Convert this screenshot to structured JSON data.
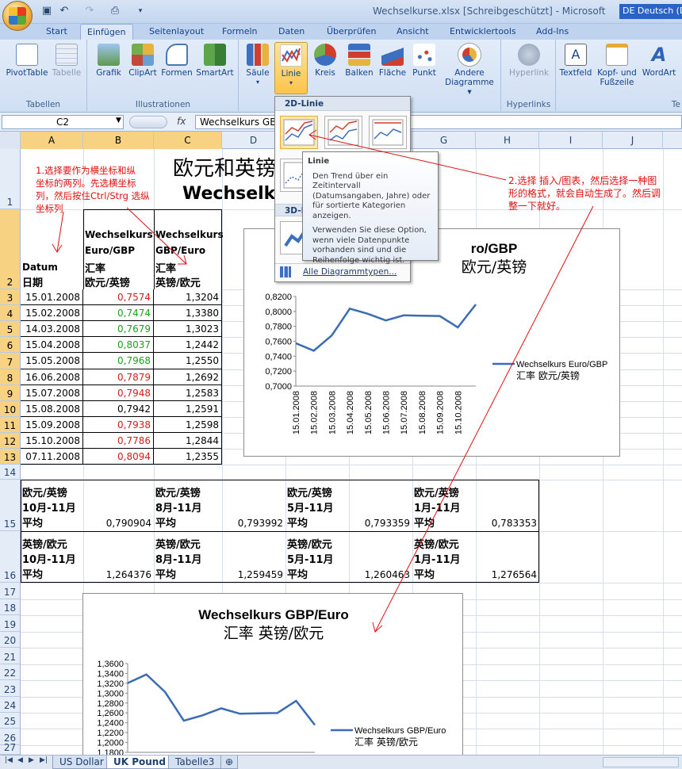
{
  "app": {
    "title": "Wechselkurse.xlsx  [Schreibgeschützt] - Microsoft",
    "lang": "DE Deutsch (D"
  },
  "tabs": [
    "Start",
    "Einfügen",
    "Seitenlayout",
    "Formeln",
    "Daten",
    "Überprüfen",
    "Ansicht",
    "Entwicklertools",
    "Add-Ins"
  ],
  "ribbon": {
    "tabellen": {
      "label": "Tabellen",
      "pivot": "PivotTable",
      "tabelle": "Tabelle"
    },
    "illu": {
      "label": "Illustrationen",
      "grafik": "Grafik",
      "clipart": "ClipArt",
      "formen": "Formen",
      "smartart": "SmartArt"
    },
    "charts": {
      "saule": "Säule",
      "linie": "Linie",
      "kreis": "Kreis",
      "balken": "Balken",
      "flache": "Fläche",
      "punkt": "Punkt",
      "andere1": "Andere",
      "andere2": "Diagramme ▾"
    },
    "hyper": {
      "label": "Hyperlinks",
      "hyperlink": "Hyperlink"
    },
    "text": {
      "textfeld": "Textfeld",
      "kopf1": "Kopf- und",
      "kopf2": "Fußzeile",
      "wordart": "WordArt",
      "label": "Te"
    }
  },
  "formula": {
    "namebox": "C2",
    "fx": "fx",
    "value": "Wechselkurs GB"
  },
  "columns": [
    "A",
    "B",
    "C",
    "D",
    "E",
    "F",
    "G",
    "H",
    "I",
    "J"
  ],
  "rows": [
    "1",
    "2",
    "3",
    "4",
    "5",
    "6",
    "7",
    "8",
    "9",
    "10",
    "11",
    "12",
    "13",
    "14",
    "15",
    "16",
    "17",
    "18",
    "19",
    "20",
    "21",
    "22",
    "23",
    "24",
    "25",
    "26",
    "27"
  ],
  "sheet": {
    "title_cn": "欧元和英镑",
    "title_de": "Wechselk",
    "header_a1": "Datum",
    "header_a2": "日期",
    "header_b1": "Wechselkurs",
    "header_b2": "Euro/GBP",
    "header_b3": "汇率",
    "header_b4": "欧元/英镑",
    "header_c1": "Wechselkurs",
    "header_c2": "GBP/Euro",
    "header_c3": "汇率",
    "header_c4": "英镑/欧元",
    "data": [
      {
        "d": "15.01.2008",
        "b": "0,7574",
        "c": "1,3204",
        "col": "red"
      },
      {
        "d": "15.02.2008",
        "b": "0,7474",
        "c": "1,3380",
        "col": "green"
      },
      {
        "d": "14.03.2008",
        "b": "0,7679",
        "c": "1,3023",
        "col": "green"
      },
      {
        "d": "15.04.2008",
        "b": "0,8037",
        "c": "1,2442",
        "col": "green"
      },
      {
        "d": "15.05.2008",
        "b": "0,7968",
        "c": "1,2550",
        "col": "green"
      },
      {
        "d": "16.06.2008",
        "b": "0,7879",
        "c": "1,2692",
        "col": "red"
      },
      {
        "d": "15.07.2008",
        "b": "0,7948",
        "c": "1,2583",
        "col": "red"
      },
      {
        "d": "15.08.2008",
        "b": "0,7942",
        "c": "1,2591",
        "col": "black"
      },
      {
        "d": "15.09.2008",
        "b": "0,7938",
        "c": "1,2598",
        "col": "red"
      },
      {
        "d": "15.10.2008",
        "b": "0,7786",
        "c": "1,2844",
        "col": "red"
      },
      {
        "d": "07.11.2008",
        "b": "0,8094",
        "c": "1,2355",
        "col": "red"
      }
    ],
    "avg15": [
      {
        "l1": "欧元/英镑",
        "l2": "10月-11月",
        "l3": "平均",
        "v": "0,790904"
      },
      {
        "l1": "欧元/英镑",
        "l2": "8月-11月",
        "l3": "平均",
        "v": "0,793992"
      },
      {
        "l1": "欧元/英镑",
        "l2": "5月-11月",
        "l3": "平均",
        "v": "0,793359"
      },
      {
        "l1": "欧元/英镑",
        "l2": "1月-11月",
        "l3": "平均",
        "v": "0,783353"
      }
    ],
    "avg16": [
      {
        "l1": "英镑/欧元",
        "l2": "10月-11月",
        "l3": "平均",
        "v": "1,264376"
      },
      {
        "l1": "英镑/欧元",
        "l2": "8月-11月",
        "l3": "平均",
        "v": "1,259459"
      },
      {
        "l1": "英镑/欧元",
        "l2": "5月-11月",
        "l3": "平均",
        "v": "1,260463"
      },
      {
        "l1": "英镑/欧元",
        "l2": "1月-11月",
        "l3": "平均",
        "v": "1,276564"
      }
    ]
  },
  "annotations": {
    "left": "1.选择要作为横坐标和纵\n坐标的两列。先选横坐标\n列，然后按住Ctrl/Strg 选纵\n坐标列",
    "right": "2.选择 插入/图表，然后选择一种图\n形的格式，就会自动生成了。然后调\n整一下就好。"
  },
  "dropdown": {
    "section1": "2D-Linie",
    "section2": "3D-L",
    "all": "Alle Diagrammtypen..."
  },
  "tooltip": {
    "title": "Linie",
    "p1": "Den Trend über ein Zeitintervall (Datumsangaben, Jahre) oder für sortierte Kategorien anzeigen.",
    "p2": "Verwenden Sie diese Option, wenn viele Datenpunkte vorhanden sind und die Reihenfolge wichtig ist."
  },
  "chart_data": [
    {
      "type": "line",
      "title": "Wechselkurs Euro/GBP",
      "subtitle": "汇率 欧元/英镑",
      "title_visible": "ro/GBP",
      "subtitle_visible": "欧元/英镑",
      "categories": [
        "15.01.2008",
        "15.02.2008",
        "14.03.2008",
        "15.04.2008",
        "15.05.2008",
        "16.06.2008",
        "15.07.2008",
        "15.08.2008",
        "15.09.2008",
        "15.10.2008",
        "07.11.2008"
      ],
      "category_labels": [
        "15.01.2008",
        "15.02.2008",
        "15.03.2008",
        "15.04.2008",
        "15.05.2008",
        "15.06.2008",
        "15.07.2008",
        "15.08.2008",
        "15.09.2008",
        "15.10.2008"
      ],
      "series": [
        {
          "name": "Wechselkurs Euro/GBP\n汇率 欧元/英镑",
          "values": [
            0.7574,
            0.7474,
            0.7679,
            0.8037,
            0.7968,
            0.7879,
            0.7948,
            0.7942,
            0.7938,
            0.7786,
            0.8094
          ]
        }
      ],
      "yticks": [
        "0,8200",
        "0,8000",
        "0,7800",
        "0,7600",
        "0,7400",
        "0,7200",
        "0,7000"
      ],
      "ylim": [
        0.7,
        0.82
      ],
      "legend_l1": "Wechselkurs Euro/GBP",
      "legend_l2": "汇率 欧元/英镑",
      "color": "#3a6bb5"
    },
    {
      "type": "line",
      "title": "Wechselkurs GBP/Euro",
      "subtitle": "汇率 英镑/欧元",
      "categories": [
        "15.01.2008",
        "15.02.2008",
        "14.03.2008",
        "15.04.2008",
        "15.05.2008",
        "16.06.2008",
        "15.07.2008",
        "15.08.2008",
        "15.09.2008",
        "15.10.2008",
        "07.11.2008"
      ],
      "series": [
        {
          "name": "Wechselkurs GBP/Euro\n汇率 英镑/欧元",
          "values": [
            1.3204,
            1.338,
            1.3023,
            1.2442,
            1.255,
            1.2692,
            1.2583,
            1.2591,
            1.2598,
            1.2844,
            1.2355
          ]
        }
      ],
      "yticks": [
        "1,3600",
        "1,3400",
        "1,3200",
        "1,3000",
        "1,2800",
        "1,2600",
        "1,2400",
        "1,2200",
        "1,2000",
        "1,1800"
      ],
      "ylim": [
        1.18,
        1.36
      ],
      "legend_l1": "Wechselkurs GBP/Euro",
      "legend_l2": "汇率 英镑/欧元",
      "color": "#3a6bb5"
    }
  ],
  "sheet_tabs": [
    "US Dollar",
    "UK Pound",
    "Tabelle3"
  ]
}
